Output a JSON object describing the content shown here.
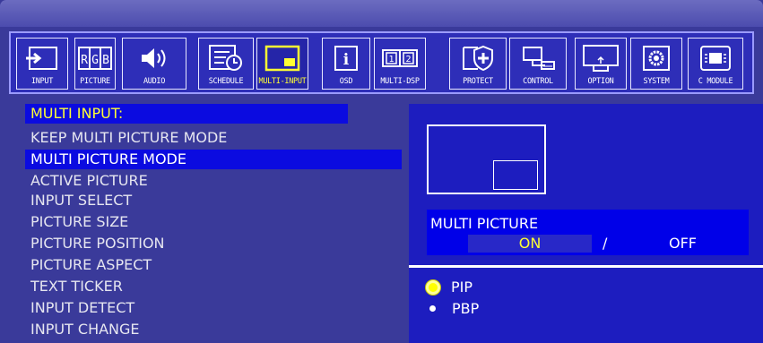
{
  "toolbar": {
    "items": [
      {
        "label": "INPUT",
        "icon": "input-arrow-icon"
      },
      {
        "label": "PICTURE",
        "icon": "rgb-icon"
      },
      {
        "label": "AUDIO",
        "icon": "speaker-icon"
      },
      {
        "label": "SCHEDULE",
        "icon": "schedule-clock-icon"
      },
      {
        "label": "MULTI-INPUT",
        "icon": "multi-input-icon"
      },
      {
        "label": "OSD",
        "icon": "info-icon"
      },
      {
        "label": "MULTI-DSP",
        "icon": "multi-display-icon"
      },
      {
        "label": "PROTECT",
        "icon": "shield-icon"
      },
      {
        "label": "CONTROL",
        "icon": "computer-control-icon"
      },
      {
        "label": "OPTION",
        "icon": "monitor-option-icon"
      },
      {
        "label": "SYSTEM",
        "icon": "gear-icon"
      },
      {
        "label": "C MODULE",
        "icon": "chip-module-icon"
      }
    ],
    "icon_text": {
      "picture": "RGB",
      "multi_dsp_1": "1",
      "multi_dsp_2": "2",
      "osd": "i"
    }
  },
  "menu": {
    "header": "MULTI INPUT:",
    "items": [
      "KEEP MULTI PICTURE MODE",
      "MULTI PICTURE MODE",
      "ACTIVE PICTURE",
      "INPUT SELECT",
      "PICTURE SIZE",
      "PICTURE POSITION",
      "PICTURE ASPECT",
      "TEXT TICKER",
      "INPUT DETECT",
      "INPUT CHANGE"
    ],
    "selected_index": 1
  },
  "panel": {
    "multi_picture_label": "MULTI PICTURE",
    "on_label": "ON",
    "separator": "/",
    "off_label": "OFF",
    "options": [
      "PIP",
      "PBP"
    ],
    "selected_option": "PIP"
  },
  "colors": {
    "background": "#3a3a9a",
    "highlight": "#0b0be0",
    "accent_yellow": "#ffff33",
    "panel": "#1d1dbf"
  }
}
